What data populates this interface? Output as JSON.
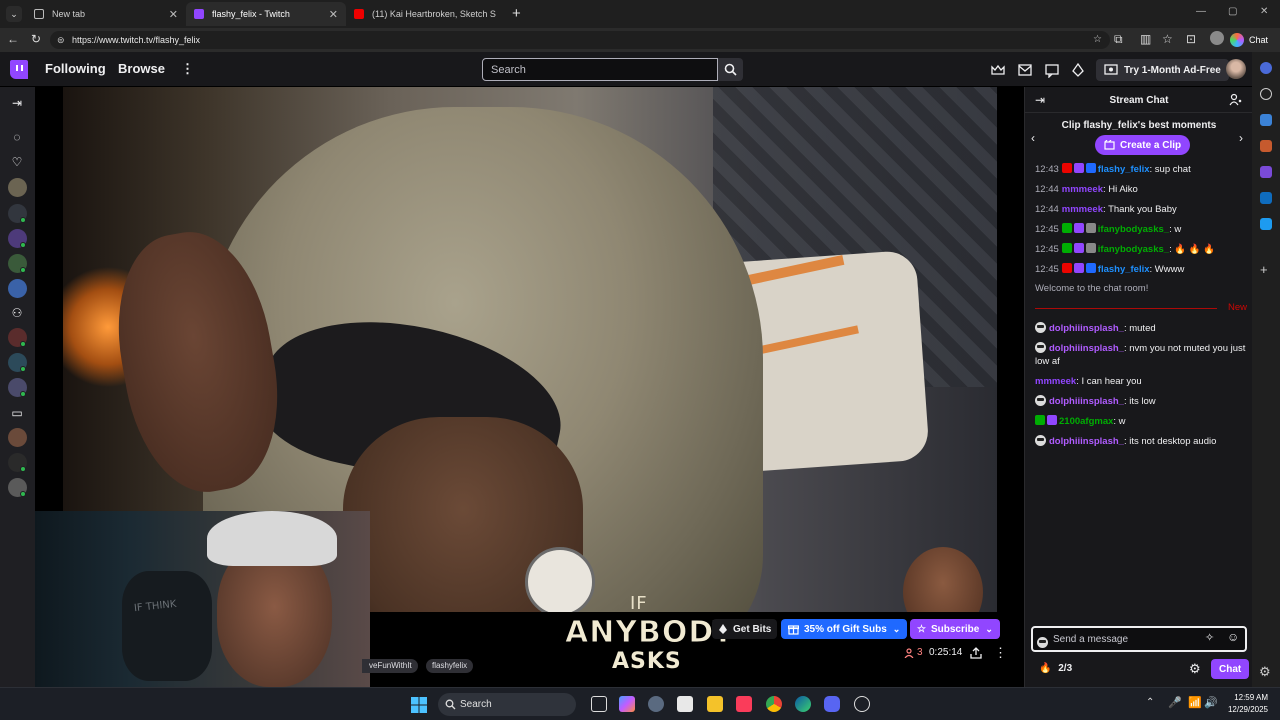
{
  "browser": {
    "tabs": [
      {
        "title": "New tab",
        "active": false
      },
      {
        "title": "flashy_felix - Twitch",
        "active": true
      },
      {
        "title": "(11) Kai Heartbroken, Sketch S",
        "active": false
      }
    ],
    "url": "https://www.twitch.tv/flashy_felix",
    "copilot_label": "Chat"
  },
  "topnav": {
    "following": "Following",
    "browse": "Browse",
    "search_placeholder": "Search",
    "adfree_label": "Try 1-Month Ad-Free"
  },
  "video": {
    "overlay_if": "IF",
    "overlay_anybody": "ANYBODY",
    "overlay_asks": "ASKS",
    "webcam_chair_text": "IF THINK"
  },
  "stream_info": {
    "get_bits": "Get Bits",
    "gift_subs": "35% off Gift Subs",
    "subscribe": "Subscribe",
    "tags": [
      "veFunWithIt",
      "flashyfelix"
    ],
    "viewers": "3",
    "uptime": "0:25:14"
  },
  "chat": {
    "title": "Stream Chat",
    "clip_title": "Clip flashy_felix's best moments",
    "create_clip": "Create a Clip",
    "messages_before": [
      {
        "time": "12:43",
        "user": "flashy_felix",
        "color": "#1e90ff",
        "text": ": sup chat",
        "badges": [
          "#eb0400",
          "#9146ff",
          "#1f69ff"
        ]
      },
      {
        "time": "12:44",
        "user": "mmmeek",
        "color": "#9146ff",
        "text": ": Hi Aiko",
        "badges": []
      },
      {
        "time": "12:44",
        "user": "mmmeek",
        "color": "#9146ff",
        "text": ": Thank you Baby",
        "badges": []
      },
      {
        "time": "12:45",
        "user": "ifanybodyasks_",
        "color": "#00ad03",
        "text": ": w",
        "badges": [
          "#00ad03",
          "#9146ff",
          "#888888"
        ]
      },
      {
        "time": "12:45",
        "user": "ifanybodyasks_",
        "color": "#00ad03",
        "text": ": 🔥 🔥 🔥",
        "badges": [
          "#00ad03",
          "#9146ff",
          "#888888"
        ]
      },
      {
        "time": "12:45",
        "user": "flashy_felix",
        "color": "#1e90ff",
        "text": ": Wwww",
        "badges": [
          "#eb0400",
          "#9146ff",
          "#1f69ff"
        ]
      }
    ],
    "welcome": "Welcome to the chat room!",
    "new_label": "New",
    "messages_after": [
      {
        "user": "dolphiiinsplash_",
        "color": "#b05cff",
        "text": ": muted",
        "skull": true,
        "badges": []
      },
      {
        "user": "dolphiiinsplash_",
        "color": "#b05cff",
        "text": ": nvm you not muted you just low af",
        "skull": true,
        "badges": []
      },
      {
        "user": "mmmeek",
        "color": "#9146ff",
        "text": ": I can hear you",
        "skull": false,
        "badges": []
      },
      {
        "user": "dolphiiinsplash_",
        "color": "#b05cff",
        "text": ": its low",
        "skull": true,
        "badges": []
      },
      {
        "user": "2100afgmax",
        "color": "#00ad03",
        "text": ": w",
        "skull": false,
        "badges": [
          "#00ad03",
          "#9146ff"
        ]
      },
      {
        "user": "dolphiiinsplash_",
        "color": "#b05cff",
        "text": ": its not desktop audio",
        "skull": true,
        "badges": []
      }
    ],
    "send_placeholder": "Send a message",
    "points": "2/3",
    "chat_button": "Chat"
  },
  "taskbar": {
    "search_label": "Search",
    "time": "12:59 AM",
    "date": "12/29/2025"
  },
  "colors": {
    "twitch_purple": "#9146ff",
    "gift_blue": "#1f69ff",
    "live_red": "#eb0400"
  }
}
